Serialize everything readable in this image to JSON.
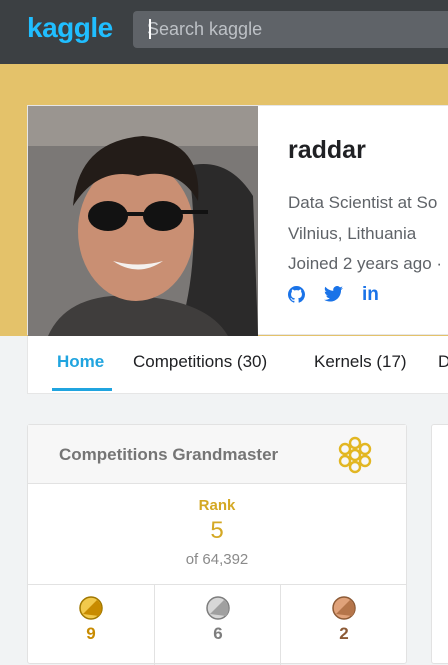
{
  "header": {
    "logo": "kaggle",
    "search_placeholder": "Search kaggle"
  },
  "profile": {
    "username": "raddar",
    "occupation": "Data Scientist at So",
    "location": "Vilnius, Lithuania",
    "joined": "Joined 2 years ago ·",
    "social": [
      "github-icon",
      "twitter-icon",
      "linkedin-icon"
    ]
  },
  "tabs": [
    {
      "label": "Home",
      "active": true
    },
    {
      "label": "Competitions (30)",
      "active": false
    },
    {
      "label": "Kernels (17)",
      "active": false
    },
    {
      "label": "D",
      "active": false
    }
  ],
  "tier": {
    "title": "Competitions Grandmaster",
    "rank_label": "Rank",
    "rank_value": "5",
    "rank_of": "of 64,392",
    "medals": [
      {
        "type": "gold",
        "count": "9",
        "color": "#d4a017",
        "text_color": "#c88b00"
      },
      {
        "type": "silver",
        "count": "6",
        "color": "#a8a8a8",
        "text_color": "#7d7d7d"
      },
      {
        "type": "bronze",
        "count": "2",
        "color": "#b5754a",
        "text_color": "#8c5a36"
      }
    ]
  },
  "colors": {
    "accent": "#20beff",
    "banner": "#e4c26a",
    "grandmaster_gold": "#d4a824"
  }
}
